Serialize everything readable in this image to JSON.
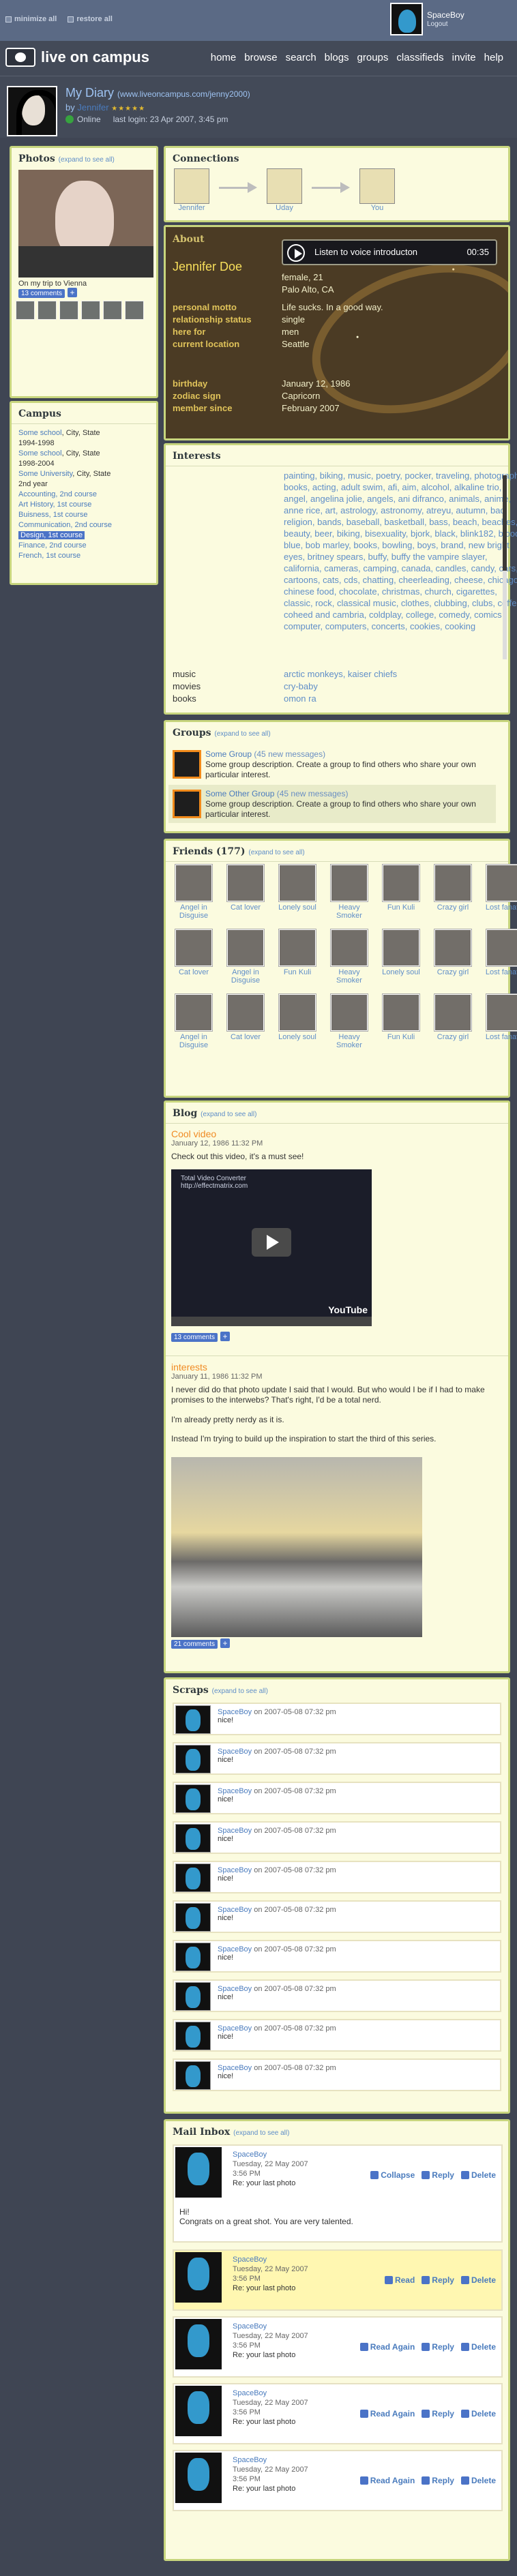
{
  "topbar": {
    "minimize": "minimize all",
    "restore": "restore all",
    "user": "SpaceBoy",
    "logout": "Logout"
  },
  "header": {
    "site": "live on campus",
    "nav": [
      "home",
      "browse",
      "search",
      "blogs",
      "groups",
      "classifieds",
      "invite",
      "help"
    ]
  },
  "profile": {
    "title": "My Diary",
    "url": "(www.liveoncampus.com/jenny2000)",
    "by": "by",
    "author": "Jennifer",
    "rating": "★★★★★",
    "online": "Online",
    "last_login": "last login:",
    "last_login_value": "23 Apr 2007, 3:45 pm"
  },
  "photos": {
    "title": "Photos",
    "expand": "(expand to see all)",
    "caption": "On my trip to Vienna",
    "comments": "13 comments"
  },
  "campus": {
    "title": "Campus",
    "items": [
      {
        "name": "Some school",
        "suffix": "City, State",
        "date": "1994-1998"
      },
      {
        "name": "Some school",
        "suffix": "City, State",
        "date": "1998-2004"
      },
      {
        "name": "Some University",
        "suffix": "City, State",
        "date": "2nd year"
      },
      {
        "name": "Accounting, 2nd course"
      },
      {
        "name": "Art History, 1st course"
      },
      {
        "name": "Buisness, 1st course"
      },
      {
        "name": "Communication, 2nd course"
      },
      {
        "name": "Design, 1st course",
        "selected": true
      },
      {
        "name": "Finance, 2nd course"
      },
      {
        "name": "French, 1st course"
      }
    ]
  },
  "connections": {
    "title": "Connections",
    "people": [
      "Jennifer",
      "Uday",
      "You"
    ]
  },
  "about": {
    "title": "About",
    "name": "Jennifer Doe",
    "audio": "Listen to voice introducton",
    "time": "00:35",
    "details": [
      "female, 21",
      "Palo Alto, CA"
    ],
    "rows": [
      {
        "label": "personal motto",
        "value": "Life sucks. In a good way."
      },
      {
        "label": "relationship status",
        "value": "single"
      },
      {
        "label": "here for",
        "value": "men"
      },
      {
        "label": "current location",
        "value": "Seattle"
      },
      {
        "label": "birthday",
        "value": "January 12, 1986"
      },
      {
        "label": "zodiac sign",
        "value": "Capricorn"
      },
      {
        "label": "member since",
        "value": "February 2007"
      }
    ]
  },
  "interests": {
    "title": "Interests",
    "text": "painting, biking, music, poetry, pocker, traveling, photography, books, acting, adult swim, afi, aim, alcohol, alkaline trio, angel, angelina jolie, angels, ani difranco, animals, anime, anne rice, art, astrology, astronomy, atreyu, autumn, bad religion, bands, baseball, basketball, bass, beach, beaches, beauty, beer, biking, bisexuality, bjork, black, blink182, blood, blue, bob marley, books, bowling, boys, brand, new bright eyes, britney spears, buffy, buffy the vampire slayer, california, cameras, camping, canada, candles, candy, cars, cartoons, cats, cds, chatting, cheerleading, cheese, chicago, chinese food, chocolate, christmas, church, cigarettes, classic, rock, classical music, clothes, clubbing, clubs, coffee, coheed and cambria, coldplay, college, comedy, comics computer, computers, concerts, cookies, cooking",
    "music_label": "music",
    "music": "arctic monkeys, kaiser chiefs",
    "movies_label": "movies",
    "movies": "cry-baby",
    "books_label": "books",
    "books": "omon ra"
  },
  "groups": {
    "title": "Groups",
    "expand": "(expand to see all)",
    "items": [
      {
        "name": "Some Group",
        "messages": "(45 new messages)",
        "desc": "Some group description. Create a group to find others who share your own particular interest."
      },
      {
        "name": "Some Other Group",
        "messages": "(45 new messages)",
        "desc": "Some group description. Create a group to find others who share your own particular interest."
      }
    ]
  },
  "friends": {
    "title": "Friends",
    "count": "(177)",
    "expand": "(expand to see all)",
    "rows": [
      [
        "Angel in Disguise",
        "Cat lover",
        "Lonely soul",
        "Heavy Smoker",
        "Fun Kuli",
        "Crazy girl",
        "Lost fanatic"
      ],
      [
        "Cat lover",
        "Angel in Disguise",
        "Fun Kuli",
        "Heavy Smoker",
        "Lonely soul",
        "Crazy girl",
        "Lost fanatic"
      ],
      [
        "Angel in Disguise",
        "Cat lover",
        "Lonely soul",
        "Heavy Smoker",
        "Fun Kuli",
        "Crazy girl",
        "Lost fanatic"
      ]
    ]
  },
  "blog": {
    "title": "Blog",
    "expand": "(expand to see all)",
    "entries": [
      {
        "title": "Cool video",
        "date": "January 12, 1986 11:32 PM",
        "text": "Check out this video, it's a must see!",
        "comments": "13 comments",
        "video_title": "Total Video Converter",
        "video_url": "http://effectmatrix.com",
        "video_brand": "YouTube"
      },
      {
        "title": "interests",
        "date": "January 11, 1986 11:32 PM",
        "text": "I never did do that photo update I said that I would. But who would I be if I had to make promises to the interwebs? That's right, I'd be a total nerd.",
        "text2": "I'm already pretty nerdy as it is.",
        "text3": "Instead I'm trying to build up the inspiration to start the third of this series.",
        "comments": "21 comments"
      }
    ]
  },
  "scraps": {
    "title": "Scraps",
    "expand": "(expand to see all)",
    "items": [
      {
        "user": "SpaceBoy",
        "on": "on 2007-05-08 07:32 pm",
        "text": "nice!"
      },
      {
        "user": "SpaceBoy",
        "on": "on 2007-05-08 07:32 pm",
        "text": "nice!"
      },
      {
        "user": "SpaceBoy",
        "on": "on 2007-05-08 07:32 pm",
        "text": "nice!"
      },
      {
        "user": "SpaceBoy",
        "on": "on 2007-05-08 07:32 pm",
        "text": "nice!"
      },
      {
        "user": "SpaceBoy",
        "on": "on 2007-05-08 07:32 pm",
        "text": "nice!"
      },
      {
        "user": "SpaceBoy",
        "on": "on 2007-05-08 07:32 pm",
        "text": "nice!"
      },
      {
        "user": "SpaceBoy",
        "on": "on 2007-05-08 07:32 pm",
        "text": "nice!"
      },
      {
        "user": "SpaceBoy",
        "on": "on 2007-05-08 07:32 pm",
        "text": "nice!"
      },
      {
        "user": "SpaceBoy",
        "on": "on 2007-05-08 07:32 pm",
        "text": "nice!"
      },
      {
        "user": "SpaceBoy",
        "on": "on 2007-05-08 07:32 pm",
        "text": "nice!"
      }
    ]
  },
  "mail": {
    "title": "Mail Inbox",
    "expand": "(expand to see all)",
    "items": [
      {
        "user": "SpaceBoy",
        "date": "Tuesday, 22 May 2007",
        "time": "3:56 PM",
        "subject": "Re: your last photo",
        "body1": "Hi!",
        "body2": "Congrats on a great shot. You are very talented.",
        "actions": [
          "Collapse",
          "Reply",
          "Delete"
        ]
      },
      {
        "user": "SpaceBoy",
        "date": "Tuesday, 22 May 2007",
        "time": "3:56 PM",
        "subject": "Re: your last photo",
        "actions": [
          "Read",
          "Reply",
          "Delete"
        ]
      },
      {
        "user": "SpaceBoy",
        "date": "Tuesday, 22 May 2007",
        "time": "3:56 PM",
        "subject": "Re: your last photo",
        "actions": [
          "Read Again",
          "Reply",
          "Delete"
        ]
      },
      {
        "user": "SpaceBoy",
        "date": "Tuesday, 22 May 2007",
        "time": "3:56 PM",
        "subject": "Re: your last photo",
        "actions": [
          "Read Again",
          "Reply",
          "Delete"
        ]
      },
      {
        "user": "SpaceBoy",
        "date": "Tuesday, 22 May 2007",
        "time": "3:56 PM",
        "subject": "Re: your last photo",
        "actions": [
          "Read Again",
          "Reply",
          "Delete"
        ]
      }
    ]
  }
}
